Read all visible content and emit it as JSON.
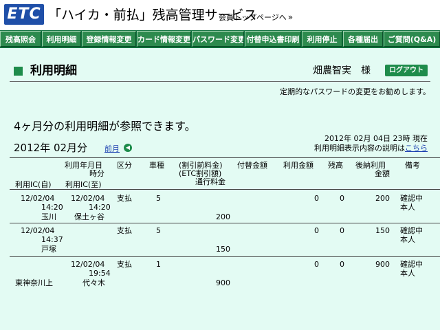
{
  "header": {
    "logo_text": "ETC",
    "service_title": "「ハイカ・前払」残高管理サービス",
    "member_top_link": "会員トップページへ",
    "member_top_arrow": "»"
  },
  "nav": {
    "items": [
      "残高照会",
      "利用明細",
      "登録情報変更",
      "カード情報変更",
      "パスワード変更",
      "付替申込書印刷",
      "利用停止",
      "各種届出",
      "ご質問(Q&A)"
    ]
  },
  "page": {
    "title": "利用明細",
    "user_name": "畑農智実　様",
    "logout_label": "ログアウト",
    "pw_notice": "定期的なパスワードの変更をお勧めします。",
    "headline": "4ヶ月分の利用明細が参照できます。",
    "period": "2012年 02月分",
    "prev_label": "前月",
    "generated_at": "2012年 02月 04日 23時 現在",
    "explain_prefix": "利用明細表示内容の説明は",
    "explain_link": "こちら"
  },
  "table": {
    "headers": {
      "usage_datetime": [
        "利用年月日",
        "時分"
      ],
      "usage_ic_from": "利用IC(自)",
      "usage_ic_to": "利用IC(至)",
      "category": "区分",
      "vehicle": "車種",
      "toll": [
        "(割引前料金)",
        "(ETC割引額)",
        "通行料金"
      ],
      "transfer": "付替金額",
      "used_amount": "利用金額",
      "balance": "残高",
      "deferred": [
        "後納利用",
        "金額"
      ],
      "notes": "備考"
    },
    "rows": [
      {
        "ic_from_date": "12/02/04",
        "ic_from_time": "14:20",
        "ic_from_name": "玉川",
        "ic_to_date": "12/02/04",
        "ic_to_time": "14:20",
        "ic_to_name": "保土ヶ谷",
        "category": "支払",
        "vehicle": "5",
        "toll": "200",
        "used_amount": "0",
        "balance": "0",
        "deferred": "200",
        "notes": [
          "確認中",
          "本人"
        ]
      },
      {
        "ic_from_date": "12/02/04",
        "ic_from_time": "14:37",
        "ic_from_name": "戸塚",
        "ic_to_date": "",
        "ic_to_time": "",
        "ic_to_name": "",
        "category": "支払",
        "vehicle": "5",
        "toll": "150",
        "used_amount": "0",
        "balance": "0",
        "deferred": "150",
        "notes": [
          "確認中",
          "本人"
        ]
      },
      {
        "ic_from_date": "",
        "ic_from_time": "",
        "ic_from_name": "東神奈川上",
        "ic_to_date": "12/02/04",
        "ic_to_time": "19:54",
        "ic_to_name": "代々木",
        "category": "支払",
        "vehicle": "1",
        "toll": "900",
        "used_amount": "0",
        "balance": "0",
        "deferred": "900",
        "notes": [
          "確認中",
          "本人"
        ]
      }
    ]
  },
  "colors": {
    "brand_blue": "#1f4fa8",
    "nav_green": "#2d8a4e",
    "content_bg": "#e3fbf3",
    "link_blue": "#1a3fb0"
  }
}
